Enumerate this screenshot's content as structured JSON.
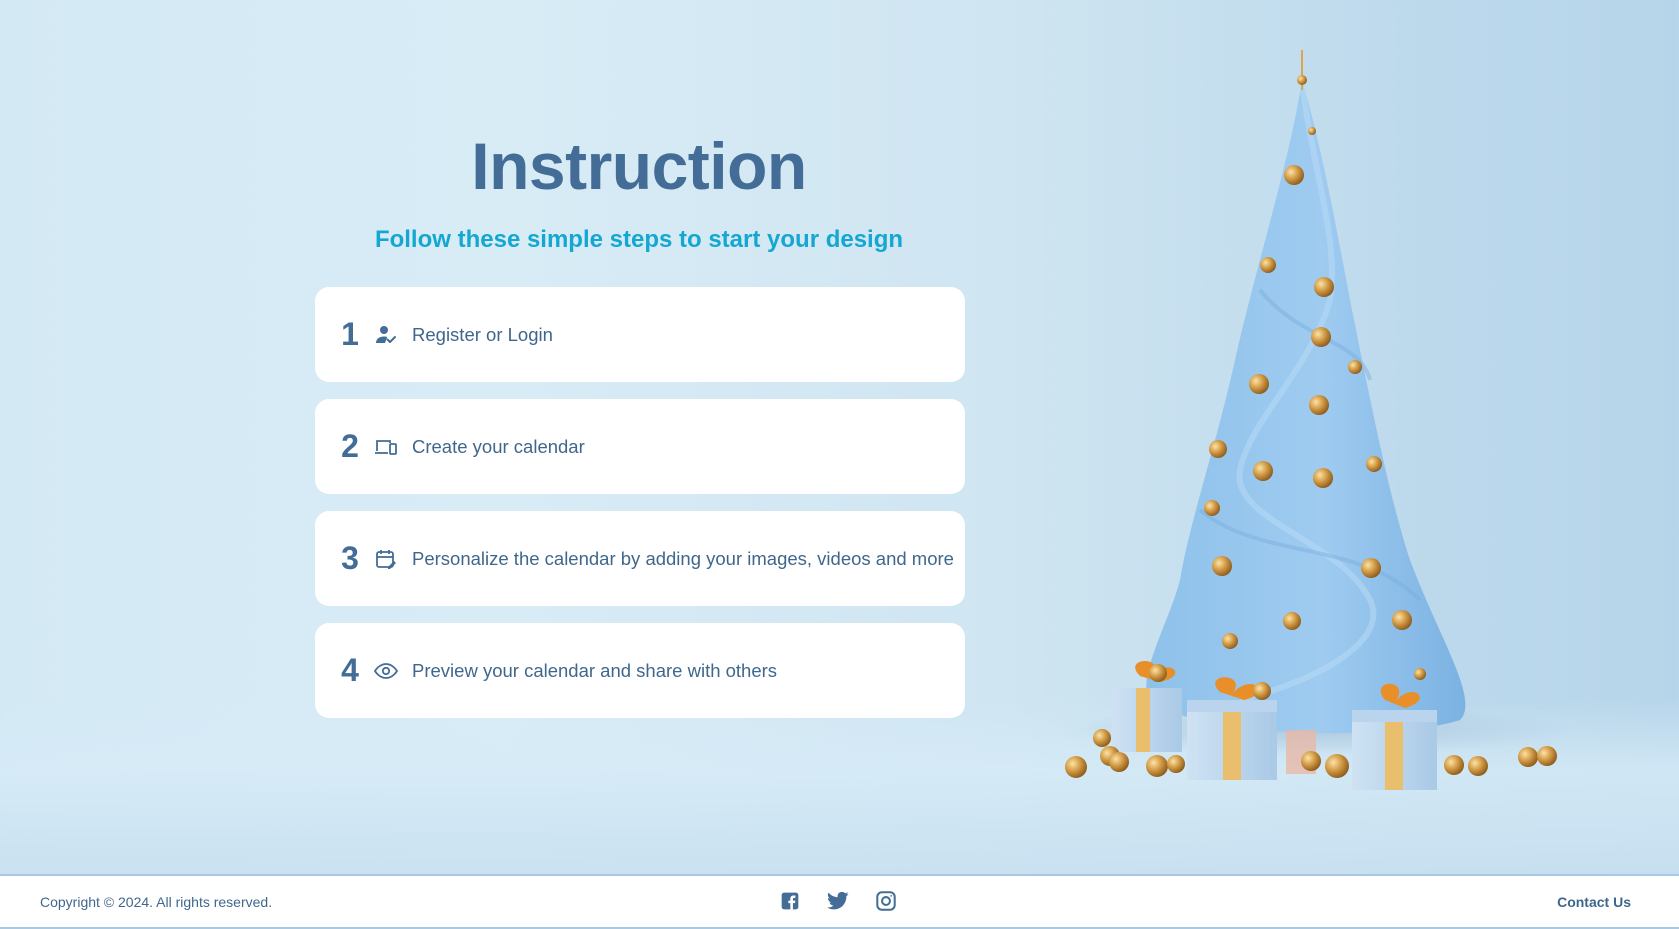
{
  "header": {
    "title": "Instruction",
    "subtitle": "Follow these simple steps to start your design"
  },
  "steps": [
    {
      "number": "1",
      "icon": "user-check-icon",
      "label": "Register or Login"
    },
    {
      "number": "2",
      "icon": "devices-icon",
      "label": "Create your calendar"
    },
    {
      "number": "3",
      "icon": "calendar-edit-icon",
      "label": "Personalize the calendar by adding your images, videos and more"
    },
    {
      "number": "4",
      "icon": "eye-icon",
      "label": "Preview your calendar and share with others"
    }
  ],
  "footer": {
    "copyright": "Copyright © 2024. All rights reserved.",
    "socials": [
      "facebook-icon",
      "twitter-icon",
      "instagram-icon"
    ],
    "contact_label": "Contact Us"
  },
  "colors": {
    "primary": "#436d96",
    "accent": "#14a7d2",
    "card": "#ffffff"
  }
}
